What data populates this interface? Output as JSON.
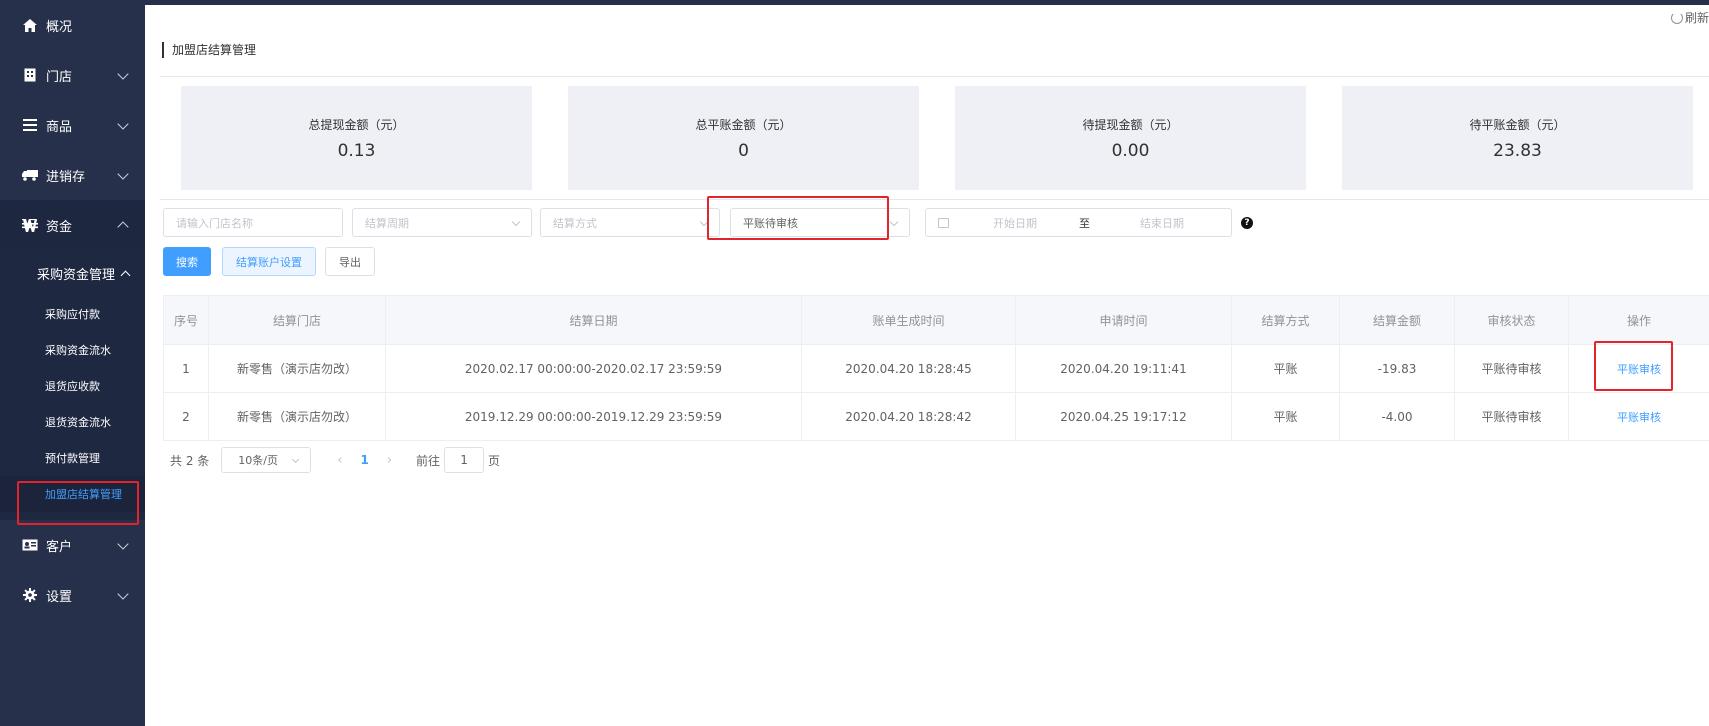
{
  "sidebar": {
    "items": [
      {
        "label": "概况",
        "icon": "home-icon"
      },
      {
        "label": "门店",
        "icon": "store-icon"
      },
      {
        "label": "商品",
        "icon": "list-icon"
      },
      {
        "label": "进销存",
        "icon": "truck-icon"
      },
      {
        "label": "资金",
        "icon": "currency-icon"
      },
      {
        "label": "客户",
        "icon": "id-card-icon"
      },
      {
        "label": "设置",
        "icon": "gear-icon"
      }
    ],
    "submenu_title": "采购资金管理",
    "sub_items": [
      "采购应付款",
      "采购资金流水",
      "退货应收款",
      "退货资金流水",
      "预付款管理",
      "加盟店结算管理"
    ]
  },
  "header": {
    "refresh_label": "刷新",
    "page_title": "加盟店结算管理"
  },
  "stats": [
    {
      "label": "总提现金额（元）",
      "value": "0.13"
    },
    {
      "label": "总平账金额（元）",
      "value": "0"
    },
    {
      "label": "待提现金额（元）",
      "value": "0.00"
    },
    {
      "label": "待平账金额（元）",
      "value": "23.83"
    }
  ],
  "filters": {
    "store_placeholder": "请输入门店名称",
    "period_placeholder": "结算周期",
    "method_placeholder": "结算方式",
    "status_value": "平账待审核",
    "start_placeholder": "开始日期",
    "range_sep": "至",
    "end_placeholder": "结束日期",
    "help": "?"
  },
  "buttons": {
    "search": "搜索",
    "account_settings": "结算账户设置",
    "export": "导出"
  },
  "table": {
    "columns": [
      "序号",
      "结算门店",
      "结算日期",
      "账单生成时间",
      "申请时间",
      "结算方式",
      "结算金额",
      "审核状态",
      "操作"
    ],
    "rows": [
      {
        "no": "1",
        "store": "新零售（演示店勿改）",
        "period": "2020.02.17 00:00:00-2020.02.17 23:59:59",
        "generated": "2020.04.20 18:28:45",
        "applied": "2020.04.20 19:11:41",
        "method": "平账",
        "amount": "-19.83",
        "status": "平账待审核",
        "action": "平账审核"
      },
      {
        "no": "2",
        "store": "新零售（演示店勿改）",
        "period": "2019.12.29 00:00:00-2019.12.29 23:59:59",
        "generated": "2020.04.20 18:28:42",
        "applied": "2020.04.25 19:17:12",
        "method": "平账",
        "amount": "-4.00",
        "status": "平账待审核",
        "action": "平账审核"
      }
    ]
  },
  "pagination": {
    "total": "共 2 条",
    "page_size": "10条/页",
    "prev": "‹",
    "current": "1",
    "next": "›",
    "goto_prefix": "前往",
    "goto_value": "1",
    "goto_suffix": "页"
  },
  "colors": {
    "accent": "#409eff",
    "sidebar": "#26304a",
    "highlight": "#e3242b"
  }
}
